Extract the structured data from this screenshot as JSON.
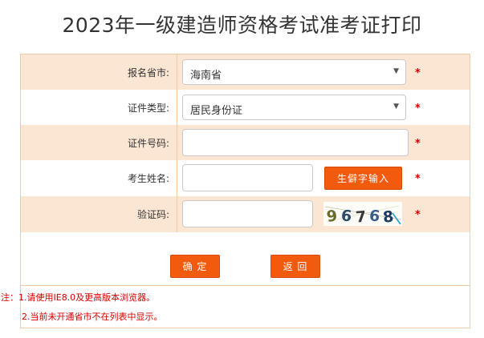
{
  "title": "2023年一级建造师资格考试准考证打印",
  "form": {
    "province": {
      "label": "报名省市:",
      "value": "海南省"
    },
    "id_type": {
      "label": "证件类型:",
      "value": "居民身份证"
    },
    "id_number": {
      "label": "证件号码:",
      "value": ""
    },
    "name": {
      "label": "考生姓名:",
      "value": "",
      "rare_char_button": "生僻字输入"
    },
    "captcha": {
      "label": "验证码:",
      "value": "",
      "image_text": "96768"
    },
    "required_mark": "*"
  },
  "buttons": {
    "confirm": "确 定",
    "back": "返 回"
  },
  "notes": [
    "注：1.请使用IE8.0及更高版本浏览器。",
    "2.当前未开通省市不在列表中显示。"
  ],
  "colors": {
    "accent": "#f25a0e",
    "row_bg": "#fbe6d3",
    "border": "#f0c9a8",
    "required": "#d40000"
  },
  "icons": {
    "select_arrow": "triangle-down-icon"
  }
}
